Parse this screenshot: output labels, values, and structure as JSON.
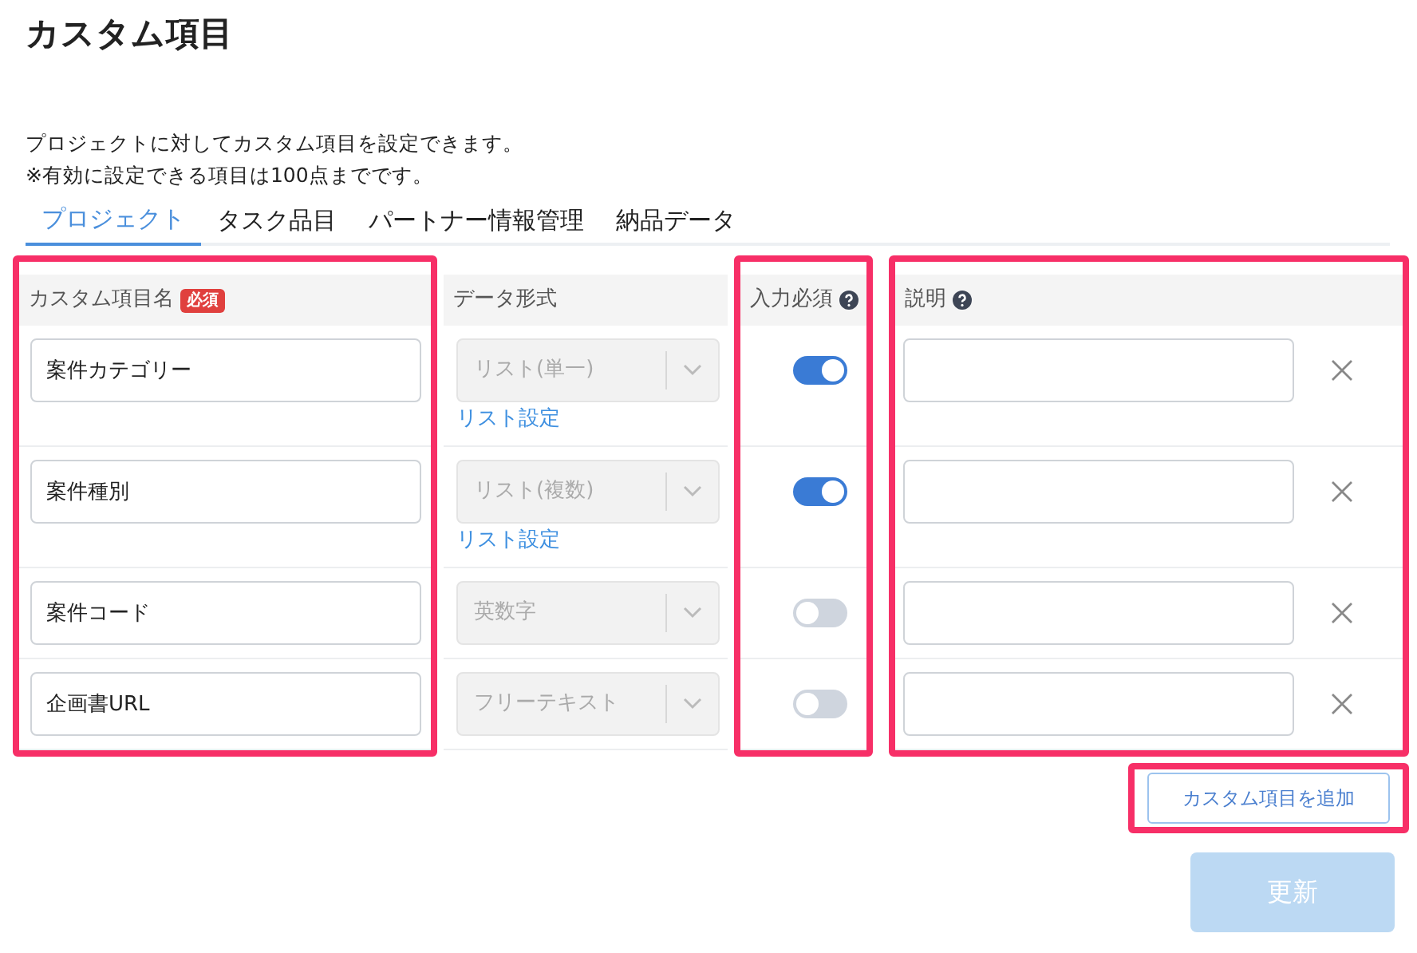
{
  "title": "カスタム項目",
  "description": [
    "プロジェクトに対してカスタム項目を設定できます。",
    "※有効に設定できる項目は100点までです。"
  ],
  "tabs": [
    {
      "label": "プロジェクト",
      "selected": true
    },
    {
      "label": "タスク品目",
      "selected": false
    },
    {
      "label": "パートナー情報管理",
      "selected": false
    },
    {
      "label": "納品データ",
      "selected": false
    }
  ],
  "table": {
    "columns": [
      {
        "label": "カスタム項目名",
        "badge": "必須",
        "help": false,
        "highlighted": true
      },
      {
        "label": "データ形式",
        "help": false,
        "highlighted": false
      },
      {
        "label": "入力必須",
        "help": true,
        "highlighted": true
      },
      {
        "label": "説明",
        "help": true,
        "highlighted": true
      }
    ],
    "rows": [
      {
        "name": "案件カテゴリー",
        "data_format": "リスト(単一)",
        "list_link": "リスト設定",
        "required": true
      },
      {
        "name": "案件種別",
        "data_format": "リスト(複数)",
        "list_link": "リスト設定",
        "required": true
      },
      {
        "name": "案件コード",
        "data_format": "英数字",
        "required": false
      },
      {
        "name": "企画書URL",
        "data_format": "フリーテキスト",
        "required": false
      }
    ]
  },
  "add_button": {
    "label": "カスタム項目を追加",
    "highlighted": true
  },
  "update_button": {
    "label": "更新",
    "disabled": true
  }
}
